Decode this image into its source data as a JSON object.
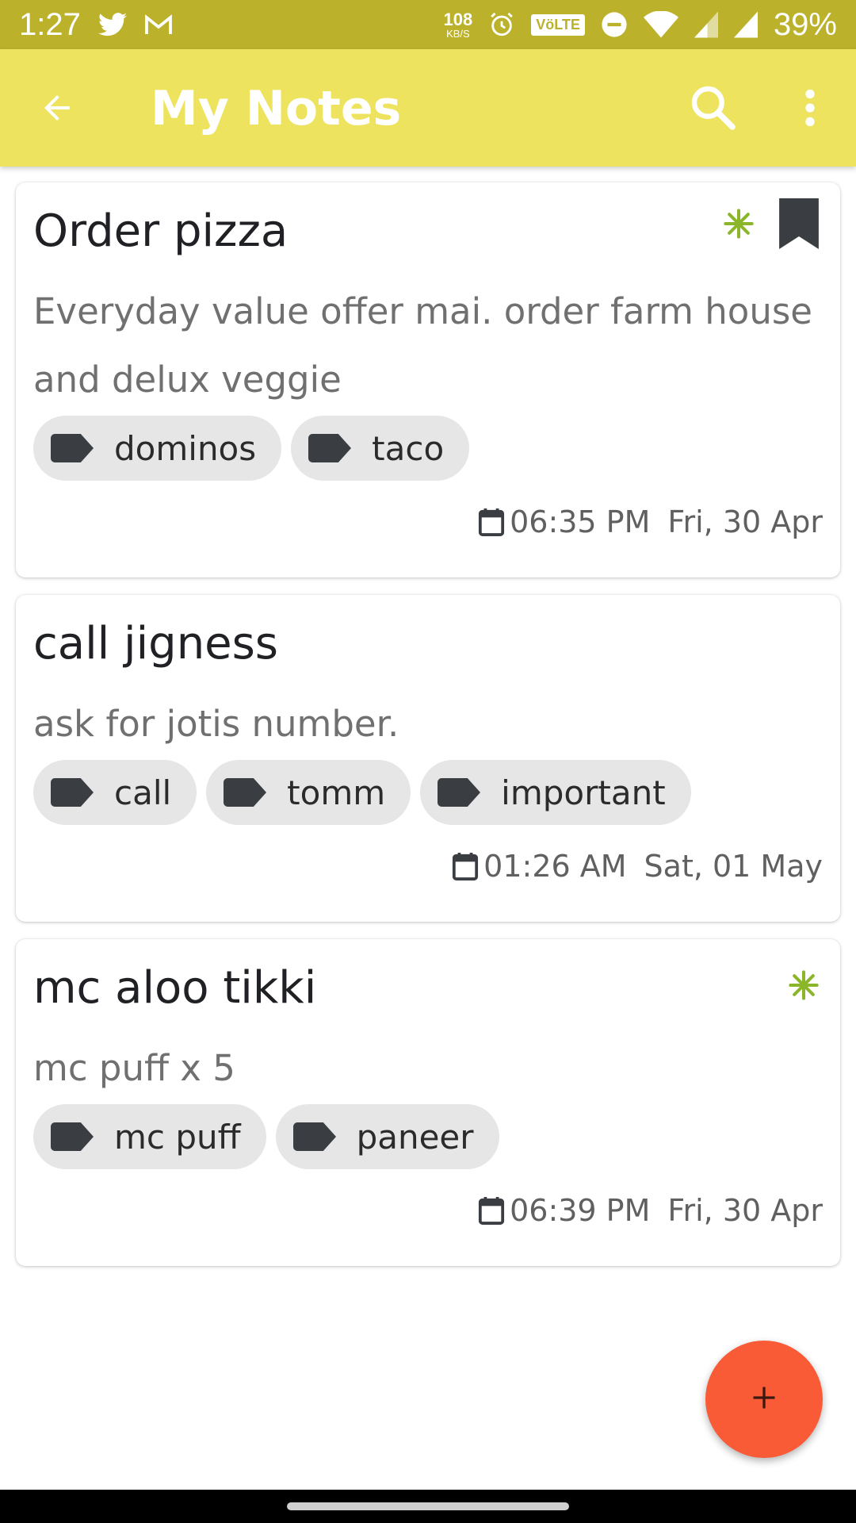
{
  "status_bar": {
    "time": "1:27",
    "net_speed_value": "108",
    "net_speed_unit": "KB/S",
    "volte_label": "VöLTE",
    "battery": "39%",
    "icons": [
      "twitter-icon",
      "gmail-icon",
      "alarm-icon",
      "dnd-icon",
      "wifi-icon",
      "signal-icon",
      "signal-icon"
    ]
  },
  "app_bar": {
    "title": "My Notes",
    "icons": [
      "back-arrow-icon",
      "search-icon",
      "more-vert-icon"
    ]
  },
  "notes": [
    {
      "title": "Order pizza",
      "body": "Everyday value offer mai. order farm house and delux veggie",
      "tags": [
        "dominos",
        "taco"
      ],
      "time": "06:35 PM",
      "date": "Fri, 30 Apr",
      "has_reminder_icon": true,
      "bookmarked": true
    },
    {
      "title": "call jigness",
      "body": "ask for jotis number.",
      "tags": [
        "call",
        "tomm",
        "important"
      ],
      "time": "01:26 AM",
      "date": "Sat, 01 May",
      "has_reminder_icon": false,
      "bookmarked": false
    },
    {
      "title": "mc aloo tikki",
      "body": "mc puff x 5",
      "tags": [
        "mc puff",
        "paneer"
      ],
      "time": "06:39 PM",
      "date": "Fri, 30 Apr",
      "has_reminder_icon": true,
      "bookmarked": false
    }
  ],
  "fab": {
    "icon": "plus-icon"
  },
  "colors": {
    "status_bar": "#bcb12b",
    "app_bar": "#ede35e",
    "fab": "#fa5b37",
    "reminder_icon": "#8bb62a",
    "tag_chip": "#e6e6e6"
  }
}
